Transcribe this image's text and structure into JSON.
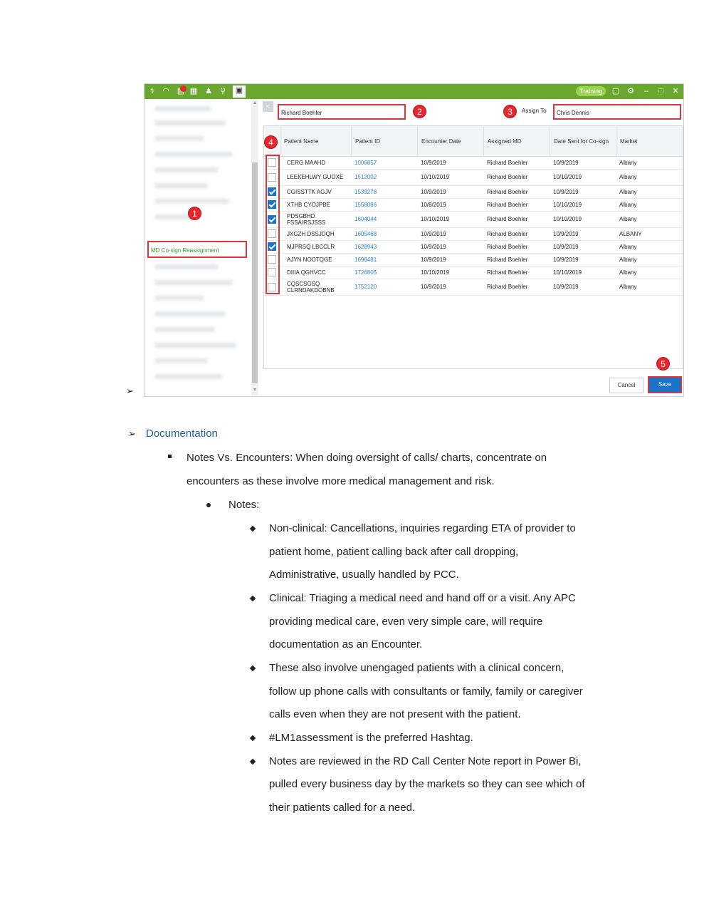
{
  "app": {
    "training_label": "Training",
    "notification_count": "9",
    "selected_md": "Richard Boehler",
    "assign_to_label": "Assign To",
    "assign_to_value": "Chris Dennis",
    "left_menu_item": "MD Co-sign Reassignment",
    "back_label": "<",
    "columns": [
      "Patient Name",
      "Patient ID",
      "Encounter Date",
      "Assigned MD",
      "Date Sent for Co-sign",
      "Market"
    ],
    "rows": [
      {
        "name": "CERG MAAHD",
        "id": "1006857",
        "enc": "10/9/2019",
        "md": "Richard Boehler",
        "sent": "10/9/2019",
        "market": "Albany",
        "checked": false
      },
      {
        "name": "LEEKEHLWY GUOXE",
        "id": "1512002",
        "enc": "10/10/2019",
        "md": "Richard Boehler",
        "sent": "10/10/2019",
        "market": "Albany",
        "checked": false
      },
      {
        "name": "CGISSTTK AGJV",
        "id": "1539278",
        "enc": "10/9/2019",
        "md": "Richard Boehler",
        "sent": "10/9/2019",
        "market": "Albany",
        "checked": true
      },
      {
        "name": "XTHB CYOJPBE",
        "id": "1558086",
        "enc": "10/8/2019",
        "md": "Richard Boehler",
        "sent": "10/10/2019",
        "market": "Albany",
        "checked": true
      },
      {
        "name": "PDSGBHD FSSAIRSJSSS",
        "id": "1604044",
        "enc": "10/10/2019",
        "md": "Richard Boehler",
        "sent": "10/10/2019",
        "market": "Albany",
        "checked": true
      },
      {
        "name": "JXGZH DSSJDQH",
        "id": "1605468",
        "enc": "10/9/2019",
        "md": "Richard Boehler",
        "sent": "10/9/2019",
        "market": "ALBANY",
        "checked": false
      },
      {
        "name": "MJPRSQ LBCCLR",
        "id": "1628943",
        "enc": "10/9/2019",
        "md": "Richard Boehler",
        "sent": "10/9/2019",
        "market": "Albany",
        "checked": true
      },
      {
        "name": "AJYN NOOTQGE",
        "id": "1698481",
        "enc": "10/9/2019",
        "md": "Richard Boehler",
        "sent": "10/9/2019",
        "market": "Albany",
        "checked": false
      },
      {
        "name": "DIIIA QGHVCC",
        "id": "1726805",
        "enc": "10/10/2019",
        "md": "Richard Boehler",
        "sent": "10/10/2019",
        "market": "Albany",
        "checked": false
      },
      {
        "name": "CQSCSGSQ CLRNDAKDOBNB",
        "id": "1752120",
        "enc": "10/9/2019",
        "md": "Richard Boehler",
        "sent": "10/9/2019",
        "market": "Albany",
        "checked": false
      }
    ],
    "cancel_label": "Cancel",
    "save_label": "Save",
    "callouts": [
      "1",
      "2",
      "3",
      "4",
      "5"
    ]
  },
  "doc": {
    "heading": "Documentation",
    "item1_line1": "Notes Vs. Encounters: When doing oversight of calls/ charts, concentrate on",
    "item1_line2": "encounters as these involve more medical management and risk.",
    "sub1": "Notes:",
    "d1": [
      "Non-clinical: Cancellations, inquiries regarding ETA of provider to",
      "patient home, patient calling back after call dropping,",
      "Administrative, usually handled by PCC."
    ],
    "d2": [
      "Clinical: Triaging a medical need and hand off or a visit.  Any APC",
      "providing medical care, even very simple care, will require",
      "documentation as an Encounter."
    ],
    "d3": [
      "These also involve unengaged patients with a clinical concern,",
      "follow up phone calls with consultants or family, family or caregiver",
      "calls even when they are not present with the patient."
    ],
    "d4": [
      "#LM1assessment is the preferred Hashtag."
    ],
    "d5": [
      "Notes are reviewed in the RD Call Center Note report in Power Bi,",
      "pulled every business day by the markets so they can see which of",
      "their patients called for a need."
    ]
  }
}
